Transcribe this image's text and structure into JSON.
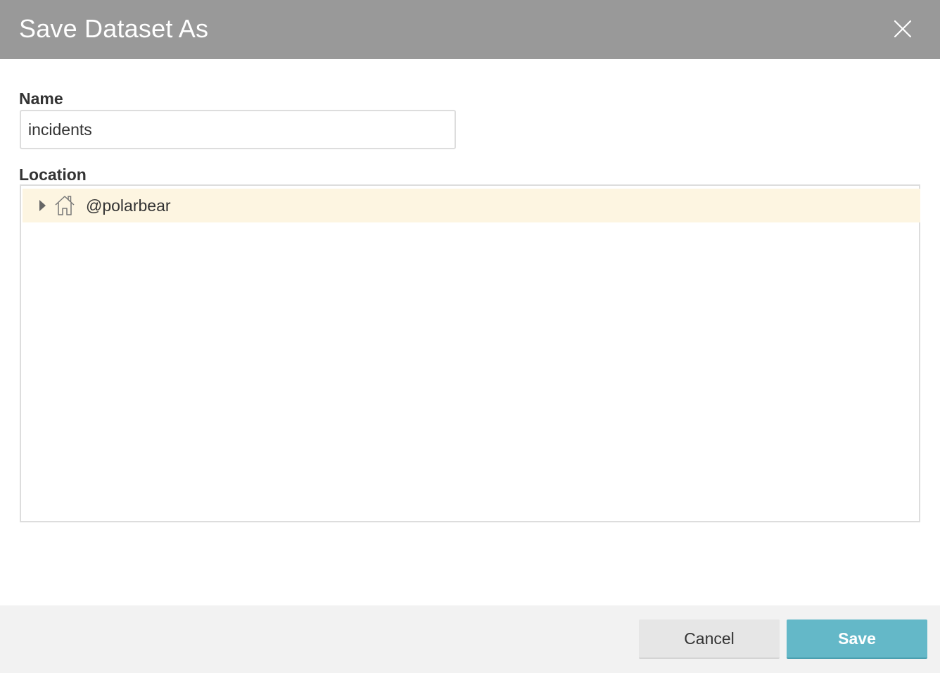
{
  "dialog": {
    "title": "Save Dataset As",
    "close_icon": "close-icon"
  },
  "form": {
    "name_label": "Name",
    "name_value": "incidents",
    "location_label": "Location"
  },
  "tree": {
    "items": [
      {
        "label": "@polarbear",
        "icon": "home-icon",
        "expander_icon": "caret-right-icon",
        "expanded": false,
        "selected": true
      }
    ]
  },
  "footer": {
    "cancel_label": "Cancel",
    "save_label": "Save"
  },
  "colors": {
    "header_bg": "#999999",
    "selected_row_bg": "#fdf5e1",
    "save_button_bg": "#64b8c8",
    "cancel_button_bg": "#e6e6e6",
    "footer_bg": "#f2f2f2"
  }
}
